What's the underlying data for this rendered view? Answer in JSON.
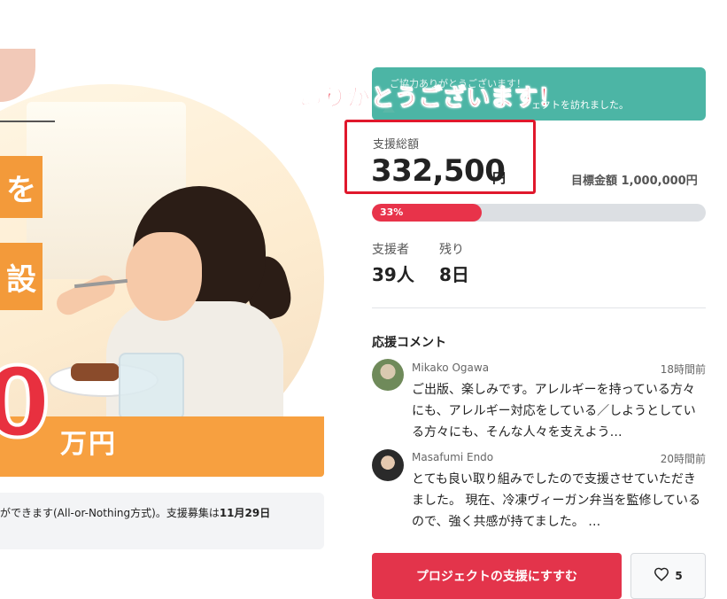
{
  "hero": {
    "label_1": "を",
    "label_2": "設",
    "big_number": "0",
    "unit": "万円"
  },
  "info": {
    "text_prefix": "ができます(All-or-Nothing方式)。支援募集は",
    "deadline": "11月29日"
  },
  "banner": {
    "line_1": "ご協力ありがとうございます！",
    "line_2": "ェクトを訪れました。"
  },
  "overlay": {
    "thanks": "ありがとうございます！"
  },
  "funding": {
    "total_label": "支援総額",
    "total_amount": "332,500",
    "currency": "円",
    "goal_text": "目標金額 1,000,000円",
    "progress_percent": 33,
    "progress_label": "33%"
  },
  "stats": {
    "supporters_label": "支援者",
    "supporters_value": "39人",
    "remaining_label": "残り",
    "remaining_value": "8日"
  },
  "comments": {
    "title": "応援コメント",
    "items": [
      {
        "name": "Mikako Ogawa",
        "time": "18時間前",
        "text": "ご出版、楽しみです。アレルギーを持っている方々にも、アレルギー対応をしている／しようとしている方々にも、そんな人々を支えよう…"
      },
      {
        "name": "Masafumi Endo",
        "time": "20時間前",
        "text": "とても良い取り組みでしたので支援させていただきました。 現在、冷凍ヴィーガン弁当を監修しているので、強く共感が持てました。 …"
      }
    ]
  },
  "actions": {
    "support_button": "プロジェクトの支援にすすむ",
    "like_count": "5"
  },
  "colors": {
    "accent_red": "#e3344b",
    "banner_teal": "#4cb5a5",
    "highlight_red": "#e0182c"
  },
  "icons": {
    "like": "heart-icon"
  }
}
